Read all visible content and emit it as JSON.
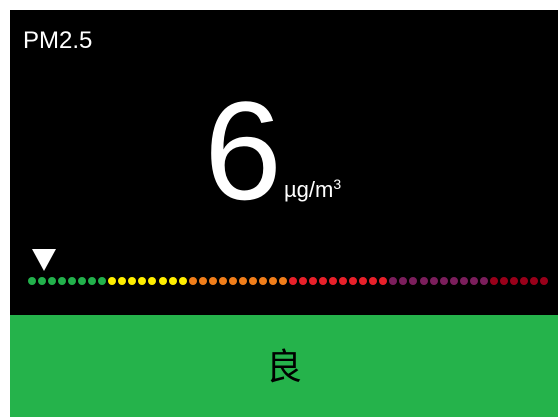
{
  "pollutant": {
    "label": "PM2.5"
  },
  "reading": {
    "value": "6",
    "unit_base": "µg/m",
    "unit_exponent": "3"
  },
  "scale": {
    "segments": [
      {
        "color": "#22b14c",
        "count": 8
      },
      {
        "color": "#ffee00",
        "count": 8
      },
      {
        "color": "#f07d1a",
        "count": 10
      },
      {
        "color": "#e8202a",
        "count": 10
      },
      {
        "color": "#7b1e5c",
        "count": 10
      },
      {
        "color": "#99001a",
        "count": 6
      }
    ],
    "current_position": 0.02
  },
  "status": {
    "label": "良",
    "color": "#25b34b"
  }
}
